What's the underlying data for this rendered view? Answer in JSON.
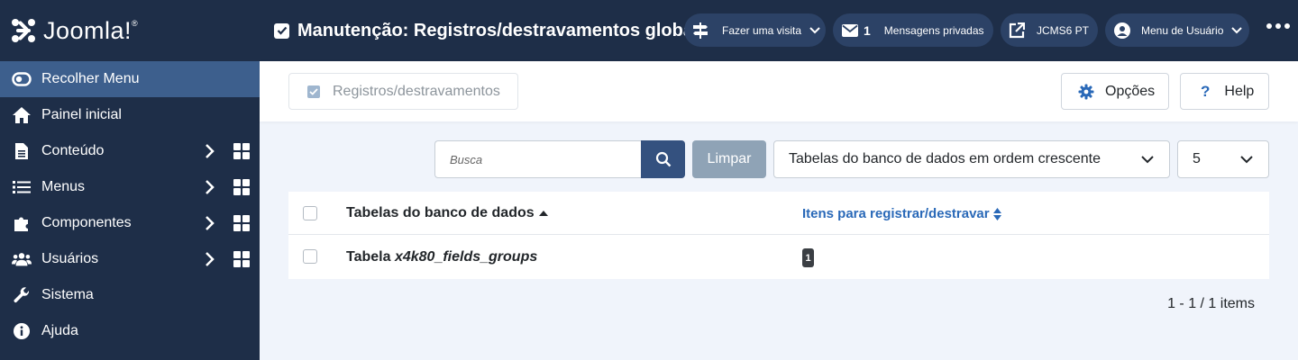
{
  "brand": {
    "name": "Joomla!",
    "reg": "®"
  },
  "sidebar": {
    "items": [
      {
        "label": "Recolher Menu",
        "icon": "toggle-icon"
      },
      {
        "label": "Painel inicial",
        "icon": "home-icon"
      },
      {
        "label": "Conteúdo",
        "icon": "file-icon"
      },
      {
        "label": "Menus",
        "icon": "list-icon"
      },
      {
        "label": "Componentes",
        "icon": "puzzle-icon"
      },
      {
        "label": "Usuários",
        "icon": "users-icon"
      },
      {
        "label": "Sistema",
        "icon": "wrench-icon"
      },
      {
        "label": "Ajuda",
        "icon": "info-icon"
      }
    ]
  },
  "header": {
    "title": "Manutenção: Registros/destravamentos globais",
    "tour_label": "Fazer uma visita",
    "messages_count": "1",
    "messages_label": "Mensagens privadas",
    "site_label": "JCMS6 PT",
    "user_menu_label": "Menu de Usuário"
  },
  "toolbar": {
    "checkin_label": "Registros/destravamentos",
    "options_label": "Opções",
    "help_label": "Help"
  },
  "filters": {
    "search_placeholder": "Busca",
    "clear_label": "Limpar",
    "sort_value": "Tabelas do banco de dados em ordem crescente",
    "limit_value": "5"
  },
  "table": {
    "col_db": "Tabelas do banco de dados",
    "col_items": "Itens para registrar/destravar",
    "rows": [
      {
        "prefix": "Tabela ",
        "name": "x4k80_fields_groups",
        "count": "1"
      }
    ]
  },
  "pagination": {
    "text": "1 - 1 / 1 items"
  },
  "colors": {
    "sidebar_bg": "#1e2e48",
    "active": "#3d5f8d",
    "link": "#2a69b8",
    "search_btn": "#34517f"
  }
}
